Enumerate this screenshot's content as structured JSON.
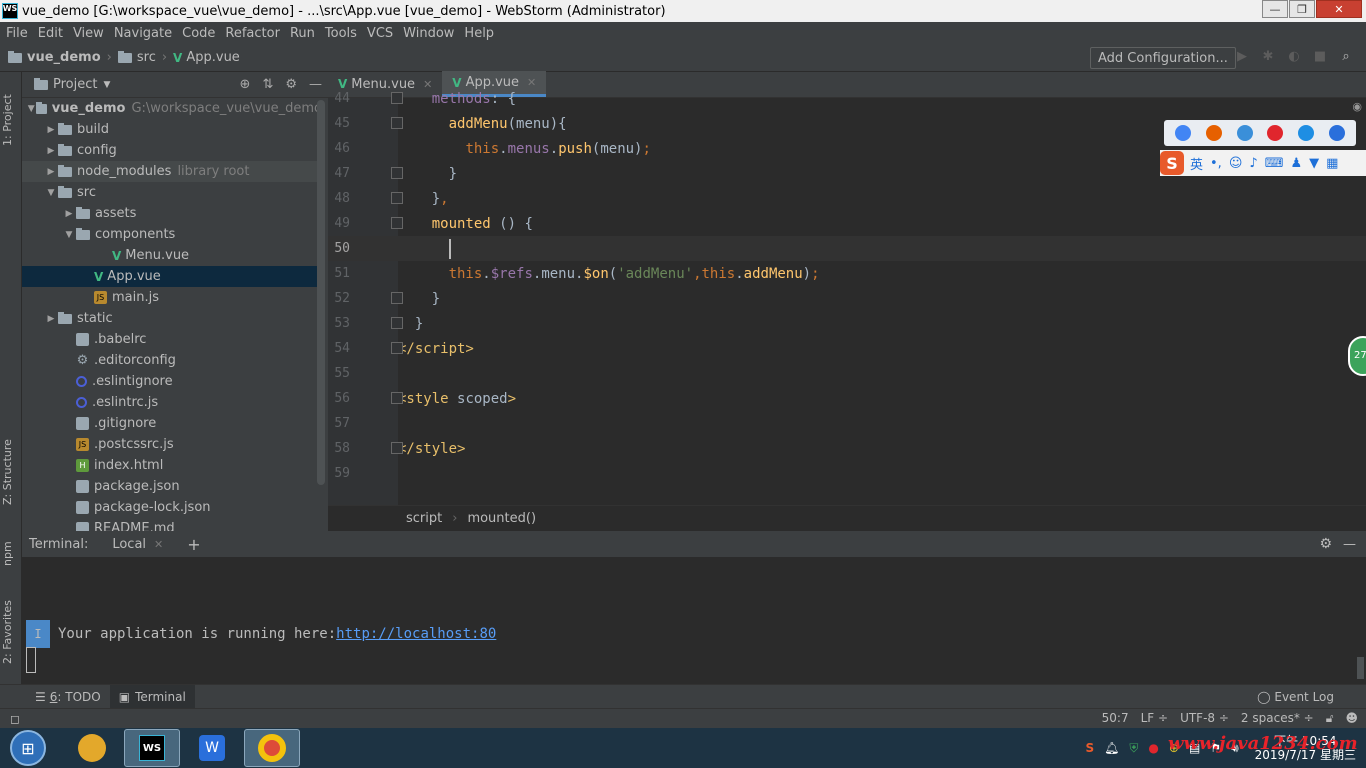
{
  "window": {
    "title": "vue_demo [G:\\workspace_vue\\vue_demo] - ...\\src\\App.vue [vue_demo] - WebStorm (Administrator)",
    "app_badge": "WS"
  },
  "menu": [
    "File",
    "Edit",
    "View",
    "Navigate",
    "Code",
    "Refactor",
    "Run",
    "Tools",
    "VCS",
    "Window",
    "Help"
  ],
  "nav": {
    "project": "vue_demo",
    "folder": "src",
    "file": "App.vue",
    "add_config": "Add Configuration..."
  },
  "left_strip": {
    "project": "1: Project",
    "structure": "Z: Structure",
    "npm": "npm",
    "favorites": "2: Favorites"
  },
  "project_panel": {
    "title": "Project",
    "tree": [
      {
        "label": "vue_demo",
        "extra": "G:\\workspace_vue\\vue_demo",
        "type": "folder",
        "arrow": "▼",
        "indent": 0
      },
      {
        "label": "build",
        "type": "folder",
        "arrow": "▶",
        "indent": 1
      },
      {
        "label": "config",
        "type": "folder",
        "arrow": "▶",
        "indent": 1
      },
      {
        "label": "node_modules",
        "extra": "library root",
        "type": "folder",
        "arrow": "▶",
        "indent": 1,
        "highlight": true
      },
      {
        "label": "src",
        "type": "folder",
        "arrow": "▼",
        "indent": 1
      },
      {
        "label": "assets",
        "type": "folder",
        "arrow": "▶",
        "indent": 2
      },
      {
        "label": "components",
        "type": "folder",
        "arrow": "▼",
        "indent": 2
      },
      {
        "label": "Menu.vue",
        "type": "vue",
        "indent": 4
      },
      {
        "label": "App.vue",
        "type": "vue",
        "indent": 3,
        "selected": true
      },
      {
        "label": "main.js",
        "type": "js",
        "indent": 3
      },
      {
        "label": "static",
        "type": "folder",
        "arrow": "▶",
        "indent": 1
      },
      {
        "label": ".babelrc",
        "type": "json",
        "indent": 2
      },
      {
        "label": ".editorconfig",
        "type": "gear",
        "indent": 2
      },
      {
        "label": ".eslintignore",
        "type": "circle",
        "indent": 2
      },
      {
        "label": ".eslintrc.js",
        "type": "circle",
        "indent": 2
      },
      {
        "label": ".gitignore",
        "type": "json",
        "indent": 2
      },
      {
        "label": ".postcssrc.js",
        "type": "js",
        "indent": 2
      },
      {
        "label": "index.html",
        "type": "html",
        "indent": 2
      },
      {
        "label": "package.json",
        "type": "json",
        "indent": 2
      },
      {
        "label": "package-lock.json",
        "type": "json",
        "indent": 2
      },
      {
        "label": "README.md",
        "type": "json",
        "indent": 2
      }
    ]
  },
  "editor": {
    "tabs": [
      {
        "label": "Menu.vue",
        "active": false
      },
      {
        "label": "App.vue",
        "active": true
      }
    ],
    "lines": [
      {
        "n": "44",
        "html": "    <span class='pr'>methods</span>: {"
      },
      {
        "n": "45",
        "html": "      <span class='fn'>addMenu</span>(menu){"
      },
      {
        "n": "46",
        "html": "        <span class='kw'>this</span>.<span class='pr'>menus</span>.<span class='fn'>push</span>(menu)<span class='kw'>;</span>"
      },
      {
        "n": "47",
        "html": "      }"
      },
      {
        "n": "48",
        "html": "    }<span class='kw'>,</span>"
      },
      {
        "n": "49",
        "html": "    <span class='fn'>mounted</span> () {"
      },
      {
        "n": "50",
        "html": "      ",
        "caret": true
      },
      {
        "n": "51",
        "html": "      <span class='kw'>this</span>.<span class='pr'>$refs</span>.menu.<span class='fn'>$on</span>(<span class='str'>'addMenu'</span><span class='kw'>,</span><span class='kw'>this</span>.<span class='fn'>addMenu</span>)<span class='kw'>;</span>"
      },
      {
        "n": "52",
        "html": "    }"
      },
      {
        "n": "53",
        "html": "  }"
      },
      {
        "n": "54",
        "html": "<span class='tag'>&lt;/script&gt;</span>"
      },
      {
        "n": "55",
        "html": ""
      },
      {
        "n": "56",
        "html": "<span class='tag'>&lt;style </span><span class='code'>scoped</span><span class='tag'>&gt;</span>"
      },
      {
        "n": "57",
        "html": ""
      },
      {
        "n": "58",
        "html": "<span class='tag'>&lt;/style&gt;</span>"
      },
      {
        "n": "59",
        "html": ""
      }
    ],
    "breadcrumb": [
      "script",
      "mounted()"
    ]
  },
  "terminal": {
    "label": "Terminal:",
    "tab": "Local",
    "output": "Your application is running here: ",
    "url": "http://localhost:80",
    "cursor_glyph": "I"
  },
  "bottom_tabs": {
    "todo_number": "6",
    "todo_label": ": TODO",
    "terminal": "Terminal",
    "event_log": "Event Log"
  },
  "status": {
    "position": "50:7",
    "line_sep": "LF ÷",
    "encoding": "UTF-8 ÷",
    "indent": "2 spaces* ÷"
  },
  "ime": {
    "label": "英",
    "badge": "27"
  },
  "taskbar": {
    "time": "下午 10:54",
    "date": "2019/7/17 星期三",
    "watermark": "www.java1234.com"
  },
  "colors": {
    "accent": "#4a88c7",
    "vue": "#41b883"
  }
}
